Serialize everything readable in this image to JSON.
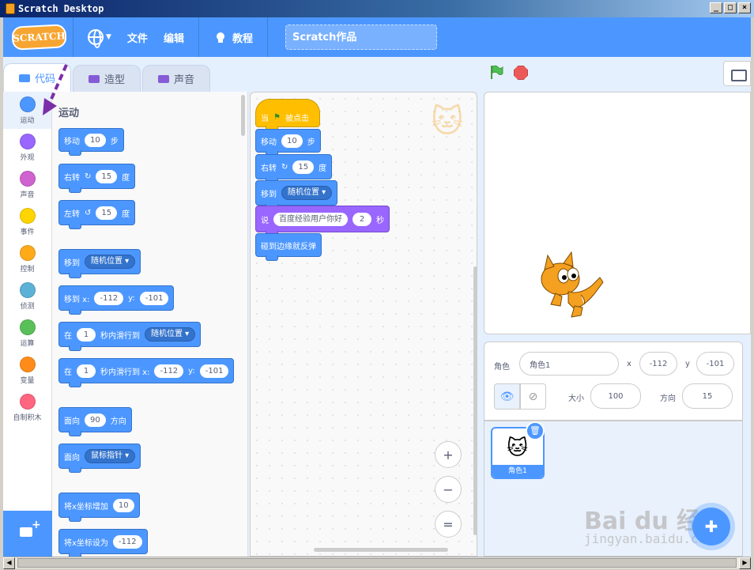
{
  "window": {
    "title": "Scratch Desktop",
    "min": "_",
    "max": "□",
    "close": "×"
  },
  "menu": {
    "logo": "SCRATCH",
    "file": "文件",
    "edit": "编辑",
    "tutorials": "教程",
    "project_title": "Scratch作品"
  },
  "tabs": [
    {
      "label": "代码"
    },
    {
      "label": "造型"
    },
    {
      "label": "声音"
    }
  ],
  "categories": [
    {
      "label": "运动",
      "color": "#4c97ff"
    },
    {
      "label": "外观",
      "color": "#9966ff"
    },
    {
      "label": "声音",
      "color": "#cf63cf"
    },
    {
      "label": "事件",
      "color": "#ffd500"
    },
    {
      "label": "控制",
      "color": "#ffab19"
    },
    {
      "label": "侦测",
      "color": "#5cb1d6"
    },
    {
      "label": "运算",
      "color": "#59c059"
    },
    {
      "label": "变量",
      "color": "#ff8c1a"
    },
    {
      "label": "自制积木",
      "color": "#ff6680"
    }
  ],
  "palette": {
    "title": "运动",
    "move": "移动",
    "move_val": "10",
    "steps": "步",
    "turn_right": "右转",
    "turn_right_val": "15",
    "deg": "度",
    "turn_left": "左转",
    "turn_left_val": "15",
    "goto": "移到",
    "random_pos": "随机位置",
    "goto_xy": "移到 x:",
    "x_val": "-112",
    "y_lbl": "y:",
    "y_val": "-101",
    "in": "在",
    "secs_val": "1",
    "glide_to": "秒内滑行到",
    "glide_xy": "秒内滑行到 x:",
    "point_dir": "面向",
    "dir_val": "90",
    "direction": "方向",
    "mouse_ptr": "鼠标指针",
    "change_x": "将x坐标增加",
    "change_x_val": "10",
    "set_x": "将x坐标设为",
    "set_x_val": "-112"
  },
  "script": {
    "when": "当",
    "clicked": "被点击",
    "move": "移动",
    "move_val": "10",
    "steps": "步",
    "turn": "右转",
    "turn_val": "15",
    "deg": "度",
    "goto": "移到",
    "goto_val": "随机位置",
    "say": "说",
    "say_text": "百度经验用户你好",
    "say_secs": "2",
    "secs": "秒",
    "bounce": "碰到边缘就反弹"
  },
  "zoom": {
    "in": "+",
    "out": "−",
    "reset": "="
  },
  "sprite": {
    "label": "角色",
    "name": "角色1",
    "x_lbl": "x",
    "x": "-112",
    "y_lbl": "y",
    "y": "-101",
    "show_lbl": "👁",
    "hide_lbl": "⊘",
    "size_lbl": "大小",
    "size": "100",
    "dir_lbl": "方向",
    "direction": "15",
    "tile_name": "角色1"
  },
  "watermark": {
    "line1": "Bai du 经验",
    "line2": "jingyan.baidu.com"
  }
}
